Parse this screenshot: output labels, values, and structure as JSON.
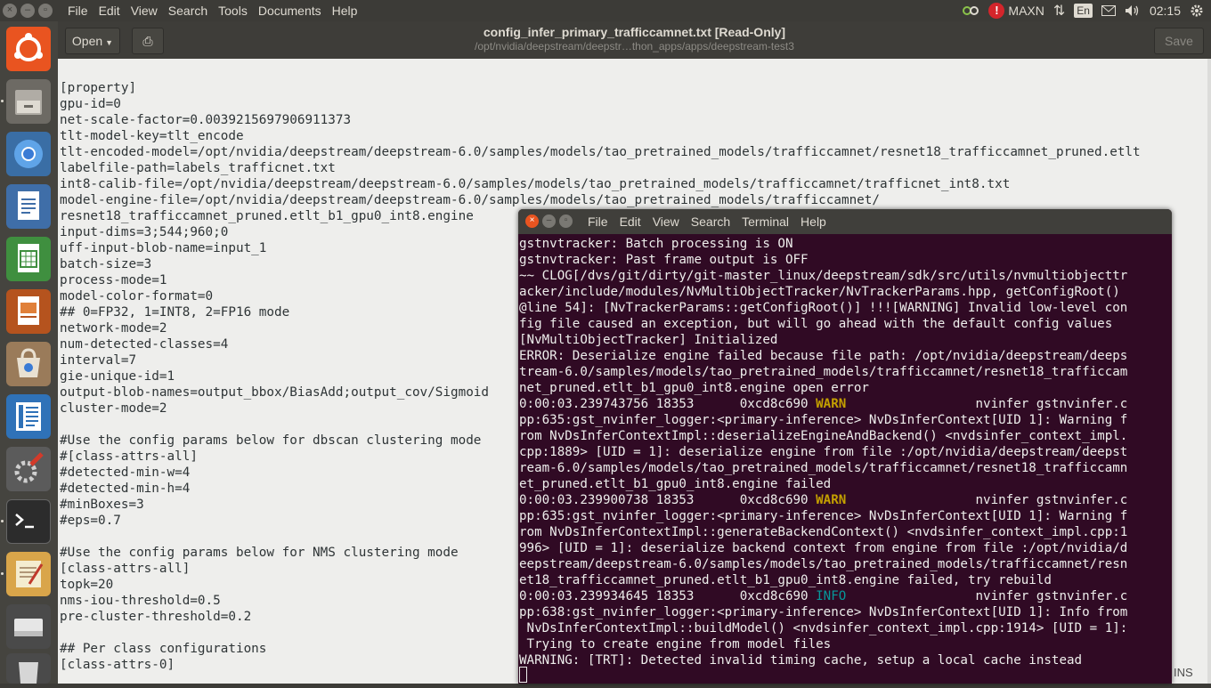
{
  "top_panel": {
    "menus": [
      "File",
      "Edit",
      "View",
      "Search",
      "Tools",
      "Documents",
      "Help"
    ],
    "power_mode": "MAXN",
    "keyboard_layout": "En",
    "clock": "02:15"
  },
  "launcher": {
    "items": [
      "ubuntu-logo",
      "files",
      "chromium",
      "writer",
      "calc",
      "impress",
      "software-center",
      "text-editor",
      "system-settings",
      "terminal",
      "gedit",
      "disk",
      "trash"
    ],
    "accent": "#e95420"
  },
  "gedit": {
    "open_label": "Open",
    "title": "config_infer_primary_trafficcamnet.txt [Read-Only]",
    "subtitle": "/opt/nvidia/deepstream/deepstr…thon_apps/apps/deepstream-test3",
    "save_label": "Save",
    "lines": [
      "[property]",
      "gpu-id=0",
      "net-scale-factor=0.0039215697906911373",
      "tlt-model-key=tlt_encode",
      "tlt-encoded-model=/opt/nvidia/deepstream/deepstream-6.0/samples/models/tao_pretrained_models/trafficcamnet/resnet18_trafficcamnet_pruned.etlt",
      "labelfile-path=labels_trafficnet.txt",
      "int8-calib-file=/opt/nvidia/deepstream/deepstream-6.0/samples/models/tao_pretrained_models/trafficcamnet/trafficnet_int8.txt",
      "model-engine-file=/opt/nvidia/deepstream/deepstream-6.0/samples/models/tao_pretrained_models/trafficcamnet/",
      "resnet18_trafficcamnet_pruned.etlt_b1_gpu0_int8.engine",
      "input-dims=3;544;960;0",
      "uff-input-blob-name=input_1",
      "batch-size=3",
      "process-mode=1",
      "model-color-format=0",
      "## 0=FP32, 1=INT8, 2=FP16 mode",
      "network-mode=2",
      "num-detected-classes=4",
      "interval=7",
      "gie-unique-id=1",
      "output-blob-names=output_bbox/BiasAdd;output_cov/Sigmoid",
      "cluster-mode=2",
      "",
      "#Use the config params below for dbscan clustering mode",
      "#[class-attrs-all]",
      "#detected-min-w=4",
      "#detected-min-h=4",
      "#minBoxes=3",
      "#eps=0.7",
      "",
      "#Use the config params below for NMS clustering mode",
      "[class-attrs-all]",
      "topk=20",
      "nms-iou-threshold=0.5",
      "pre-cluster-threshold=0.2",
      "",
      "## Per class configurations",
      "[class-attrs-0]"
    ],
    "status_mode": "INS"
  },
  "terminal": {
    "menus": [
      "File",
      "Edit",
      "View",
      "Search",
      "Terminal",
      "Help"
    ],
    "lines": [
      {
        "t": "gstnvtracker: Batch processing is ON"
      },
      {
        "t": "gstnvtracker: Past frame output is OFF"
      },
      {
        "t": "~~ CLOG[/dvs/git/dirty/git-master_linux/deepstream/sdk/src/utils/nvmultiobjecttr"
      },
      {
        "t": "acker/include/modules/NvMultiObjectTracker/NvTrackerParams.hpp, getConfigRoot()"
      },
      {
        "t": "@line 54]: [NvTrackerParams::getConfigRoot()] !!![WARNING] Invalid low-level con"
      },
      {
        "t": "fig file caused an exception, but will go ahead with the default config values"
      },
      {
        "t": "[NvMultiObjectTracker] Initialized"
      },
      {
        "t": "ERROR: Deserialize engine failed because file path: /opt/nvidia/deepstream/deeps"
      },
      {
        "t": "tream-6.0/samples/models/tao_pretrained_models/trafficcamnet/resnet18_trafficcam"
      },
      {
        "t": "net_pruned.etlt_b1_gpu0_int8.engine open error"
      },
      {
        "pre": "0:00:03.239743756 18353      0xcd8c690 ",
        "lvl": "WARN",
        "cls": "warn",
        "post": "                 nvinfer gstnvinfer.c"
      },
      {
        "t": "pp:635:gst_nvinfer_logger:<primary-inference> NvDsInferContext[UID 1]: Warning f"
      },
      {
        "t": "rom NvDsInferContextImpl::deserializeEngineAndBackend() <nvdsinfer_context_impl."
      },
      {
        "t": "cpp:1889> [UID = 1]: deserialize engine from file :/opt/nvidia/deepstream/deepst"
      },
      {
        "t": "ream-6.0/samples/models/tao_pretrained_models/trafficcamnet/resnet18_trafficcamn"
      },
      {
        "t": "et_pruned.etlt_b1_gpu0_int8.engine failed"
      },
      {
        "pre": "0:00:03.239900738 18353      0xcd8c690 ",
        "lvl": "WARN",
        "cls": "warn",
        "post": "                 nvinfer gstnvinfer.c"
      },
      {
        "t": "pp:635:gst_nvinfer_logger:<primary-inference> NvDsInferContext[UID 1]: Warning f"
      },
      {
        "t": "rom NvDsInferContextImpl::generateBackendContext() <nvdsinfer_context_impl.cpp:1"
      },
      {
        "t": "996> [UID = 1]: deserialize backend context from engine from file :/opt/nvidia/d"
      },
      {
        "t": "eepstream/deepstream-6.0/samples/models/tao_pretrained_models/trafficcamnet/resn"
      },
      {
        "t": "et18_trafficcamnet_pruned.etlt_b1_gpu0_int8.engine failed, try rebuild"
      },
      {
        "pre": "0:00:03.239934645 18353      0xcd8c690 ",
        "lvl": "INFO",
        "cls": "info",
        "post": "                 nvinfer gstnvinfer.c"
      },
      {
        "t": "pp:638:gst_nvinfer_logger:<primary-inference> NvDsInferContext[UID 1]: Info from"
      },
      {
        "t": " NvDsInferContextImpl::buildModel() <nvdsinfer_context_impl.cpp:1914> [UID = 1]:"
      },
      {
        "t": " Trying to create engine from model files"
      },
      {
        "t": "WARNING: [TRT]: Detected invalid timing cache, setup a local cache instead"
      }
    ],
    "background": "#300a24"
  }
}
